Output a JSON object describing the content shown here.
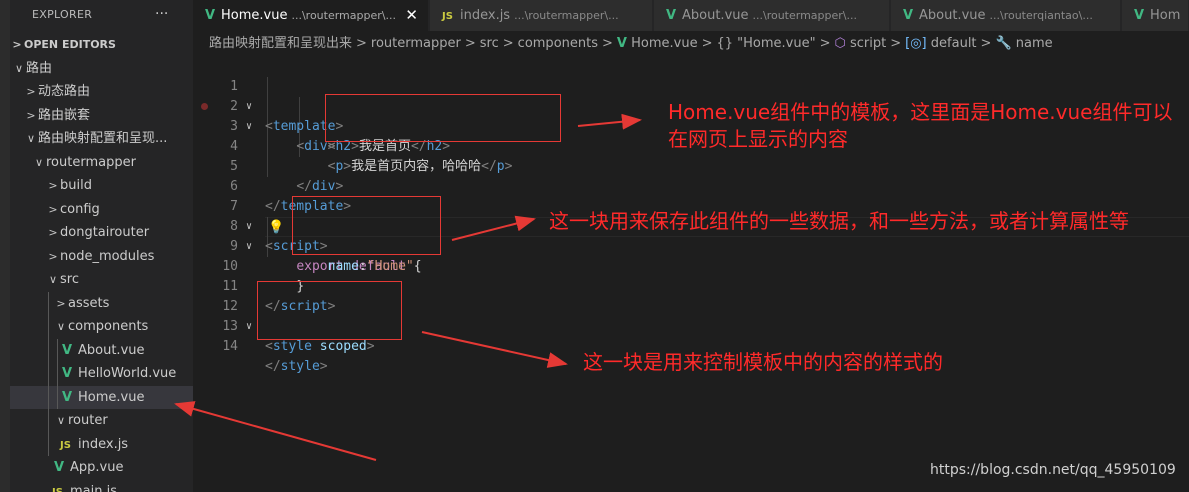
{
  "sidebar": {
    "header": "EXPLORER",
    "more": "···",
    "open_editors": "OPEN EDITORS",
    "items": [
      {
        "label": "路由",
        "chev": "∨"
      },
      {
        "label": "动态路由",
        "chev": ">"
      },
      {
        "label": "路由嵌套",
        "chev": ">"
      },
      {
        "label": "路由映射配置和呈现...",
        "chev": "∨"
      },
      {
        "label": "routermapper",
        "chev": "∨"
      },
      {
        "label": "build",
        "chev": ">"
      },
      {
        "label": "config",
        "chev": ">"
      },
      {
        "label": "dongtairouter",
        "chev": ">"
      },
      {
        "label": "node_modules",
        "chev": ">"
      },
      {
        "label": "src",
        "chev": "∨"
      },
      {
        "label": "assets",
        "chev": ">"
      },
      {
        "label": "components",
        "chev": "∨"
      },
      {
        "label": "About.vue"
      },
      {
        "label": "HelloWorld.vue"
      },
      {
        "label": "Home.vue"
      },
      {
        "label": "router",
        "chev": "∨"
      },
      {
        "label": "index.js"
      },
      {
        "label": "App.vue"
      },
      {
        "label": "main.js"
      }
    ],
    "vue_icon": "V",
    "js_icon": "JS"
  },
  "tabs": [
    {
      "name": "Home.vue",
      "path": "...\\routermapper\\...",
      "close": "✕"
    },
    {
      "name": "index.js",
      "path": "...\\routermapper\\..."
    },
    {
      "name": "About.vue",
      "path": "...\\routermapper\\..."
    },
    {
      "name": "About.vue",
      "path": "...\\routerqiantao\\..."
    },
    {
      "name": "Hom"
    }
  ],
  "breadcrumb": {
    "parts": [
      "路由映射配置和呈现出来",
      "routermapper",
      "src",
      "components"
    ],
    "file": "Home.vue",
    "braces": "{}",
    "component": "\"Home.vue\"",
    "script": "script",
    "default": "default",
    "name": "name",
    "sep": ">"
  },
  "editor": {
    "lines": [
      "1",
      "2",
      "3",
      "4",
      "5",
      "6",
      "7",
      "8",
      "9",
      "10",
      "11",
      "12",
      "13",
      "14"
    ],
    "fold_mark": "∨",
    "bulb": "💡",
    "code": {
      "l1_tag": "template",
      "l2_tag": "div",
      "l3_tag": "h2",
      "l3_text": "我是首页",
      "l4_tag": "p",
      "l4_text": "我是首页内容，哈哈哈",
      "l5_tag": "div",
      "l6_tag": "template",
      "l7_tag": "script",
      "l8_export": "export",
      "l8_default": "default",
      "l8_brace": "{",
      "l9_prop": "name",
      "l9_value": "\"Home\"",
      "l10_brace": "}",
      "l11_tag": "script",
      "l12_tag": "style",
      "l12_attr": "scoped",
      "l14_tag": "style"
    }
  },
  "annotations": {
    "template": "Home.vue组件中的模板，这里面是Home.vue组件可以在网页上显示的内容",
    "script": "这一块用来保存此组件的一些数据，和一些方法，或者计算属性等",
    "style": "这一块是用来控制模板中的内容的样式的"
  },
  "colors": {
    "annotation": "#ff2a2a",
    "vue_green": "#41b883",
    "tag_blue": "#569cd6"
  },
  "watermark": "https://blog.csdn.net/qq_45950109"
}
